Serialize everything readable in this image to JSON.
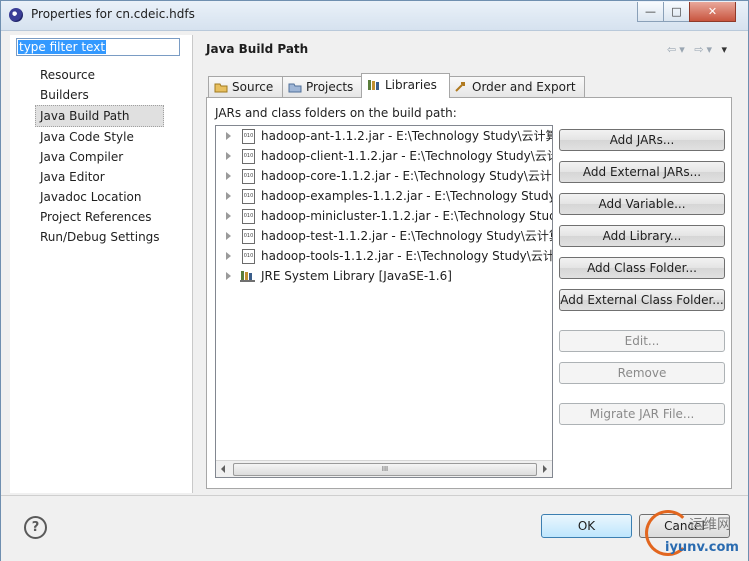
{
  "window": {
    "title": "Properties for cn.cdeic.hdfs",
    "controls": [
      "—",
      "□",
      "✕"
    ]
  },
  "left": {
    "filter_value": "type filter text",
    "nav_items": [
      {
        "label": "Resource"
      },
      {
        "label": "Builders"
      },
      {
        "label": "Java Build Path",
        "selected": true
      },
      {
        "label": "Java Code Style"
      },
      {
        "label": "Java Compiler"
      },
      {
        "label": "Java Editor"
      },
      {
        "label": "Javadoc Location"
      },
      {
        "label": "Project References"
      },
      {
        "label": "Run/Debug Settings"
      }
    ]
  },
  "main": {
    "title": "Java Build Path",
    "tabs": [
      {
        "label": "Source",
        "icon": "source-folder-icon"
      },
      {
        "label": "Projects",
        "icon": "projects-icon"
      },
      {
        "label": "Libraries",
        "icon": "libraries-icon",
        "active": true
      },
      {
        "label": "Order and Export",
        "icon": "order-export-icon"
      }
    ],
    "section_label": "JARs and class folders on the build path:",
    "libraries": [
      {
        "text": "hadoop-ant-1.1.2.jar - E:\\Technology Study\\云计算",
        "icon": "jar-icon"
      },
      {
        "text": "hadoop-client-1.1.2.jar - E:\\Technology Study\\云计",
        "icon": "jar-icon"
      },
      {
        "text": "hadoop-core-1.1.2.jar - E:\\Technology Study\\云计算",
        "icon": "jar-icon"
      },
      {
        "text": "hadoop-examples-1.1.2.jar - E:\\Technology Study\\",
        "icon": "jar-icon"
      },
      {
        "text": "hadoop-minicluster-1.1.2.jar - E:\\Technology Study",
        "icon": "jar-icon"
      },
      {
        "text": "hadoop-test-1.1.2.jar - E:\\Technology Study\\云计算",
        "icon": "jar-icon"
      },
      {
        "text": "hadoop-tools-1.1.2.jar - E:\\Technology Study\\云计",
        "icon": "jar-icon"
      },
      {
        "text": "JRE System Library [JavaSE-1.6]",
        "icon": "library-icon"
      }
    ],
    "jar_glyph": "010",
    "scrollbar_grip": "III",
    "buttons": [
      {
        "label": "Add JARs...",
        "enabled": true
      },
      {
        "label": "Add External JARs...",
        "enabled": true
      },
      {
        "label": "Add Variable...",
        "enabled": true
      },
      {
        "label": "Add Library...",
        "enabled": true
      },
      {
        "label": "Add Class Folder...",
        "enabled": true
      },
      {
        "label": "Add External Class Folder...",
        "enabled": true
      },
      {
        "label": "Edit...",
        "enabled": false
      },
      {
        "label": "Remove",
        "enabled": false
      },
      {
        "label": "Migrate JAR File...",
        "enabled": false
      }
    ]
  },
  "footer": {
    "help_glyph": "?",
    "ok_label": "OK",
    "cancel_label": "Cancel"
  },
  "watermark": {
    "cn_text": "运维网",
    "url_text": "iyunv.com"
  }
}
